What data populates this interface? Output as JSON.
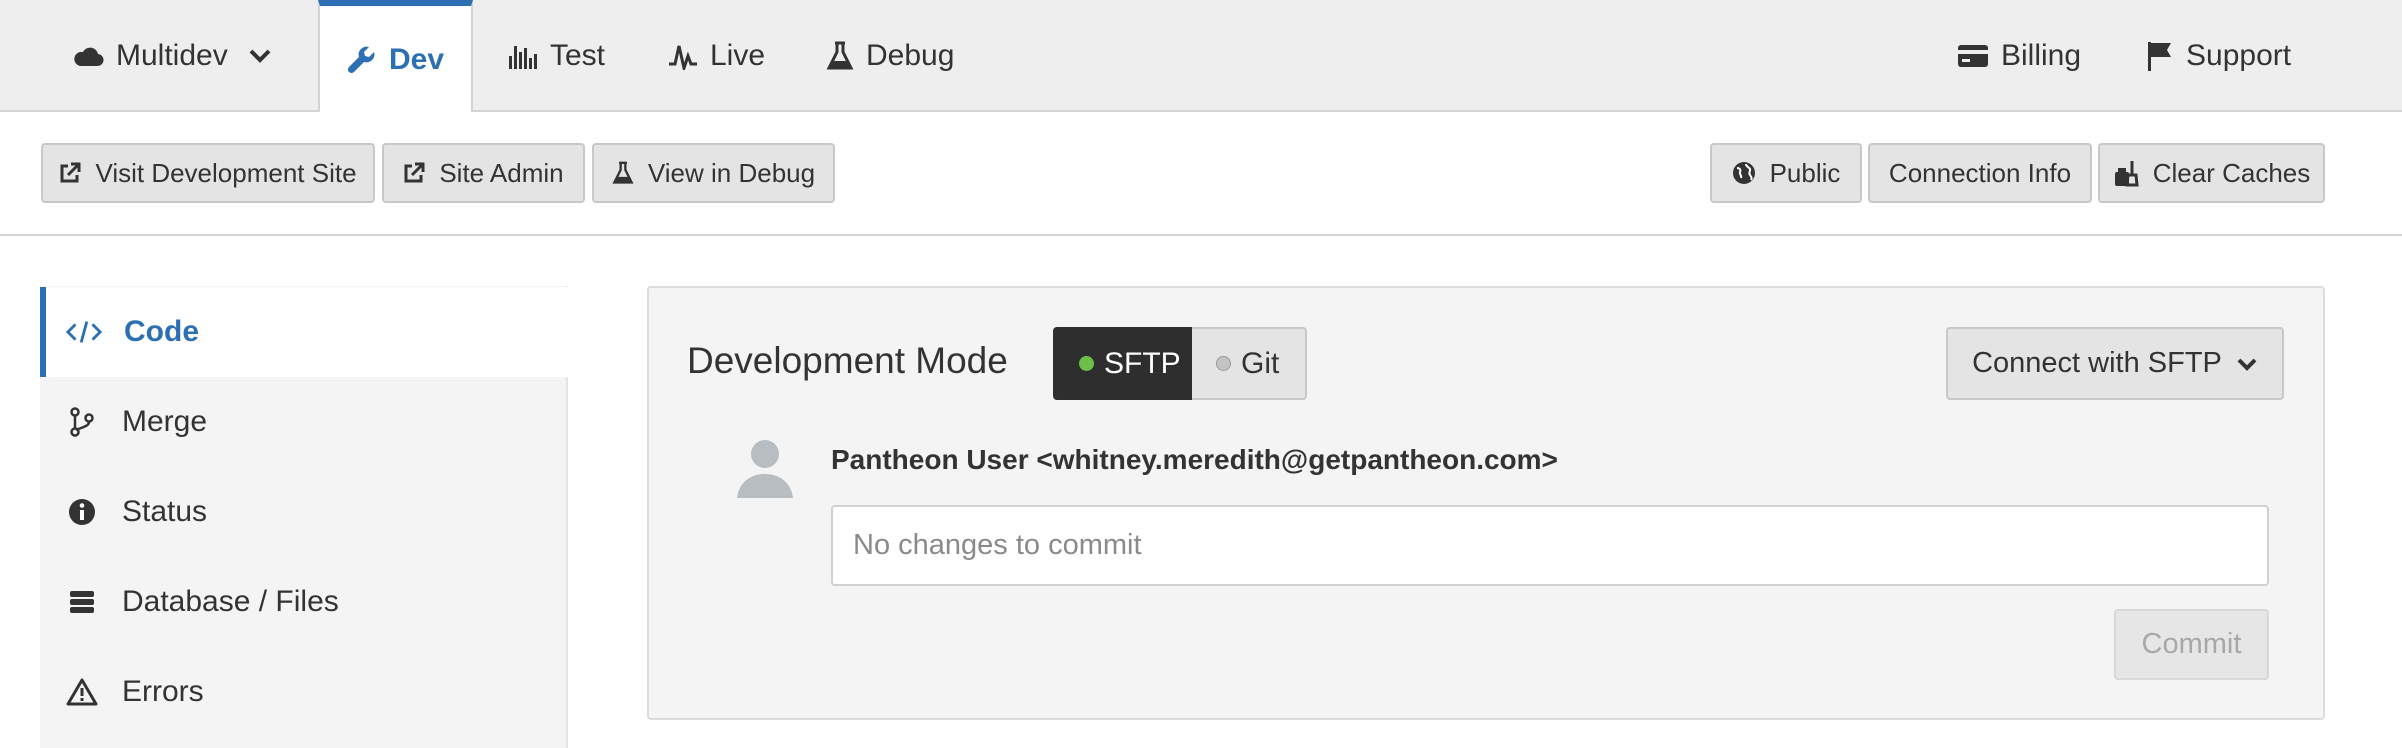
{
  "topnav": {
    "environment_label": "Multidev",
    "tabs": [
      {
        "label": "Dev",
        "icon": "wrench-icon"
      },
      {
        "label": "Test",
        "icon": "bar-chart-icon"
      },
      {
        "label": "Live",
        "icon": "pulse-icon"
      },
      {
        "label": "Debug",
        "icon": "flask-icon"
      }
    ],
    "right_links": [
      {
        "label": "Billing",
        "icon": "credit-card-icon"
      },
      {
        "label": "Support",
        "icon": "flag-icon"
      }
    ]
  },
  "toolbar": {
    "left_buttons": [
      {
        "label": "Visit Development Site",
        "icon": "external-link-icon"
      },
      {
        "label": "Site Admin",
        "icon": "external-link-icon"
      },
      {
        "label": "View in Debug",
        "icon": "flask-icon"
      }
    ],
    "right_buttons": [
      {
        "label": "Public",
        "icon": "globe-icon"
      },
      {
        "label": "Connection Info"
      },
      {
        "label": "Clear Caches",
        "icon": "broom-icon"
      }
    ]
  },
  "sidebar": {
    "items": [
      {
        "label": "Code",
        "icon": "code-icon",
        "active": true
      },
      {
        "label": "Merge",
        "icon": "branch-icon"
      },
      {
        "label": "Status",
        "icon": "info-icon"
      },
      {
        "label": "Database / Files",
        "icon": "database-icon"
      },
      {
        "label": "Errors",
        "icon": "warning-icon"
      }
    ]
  },
  "main": {
    "title": "Development Mode",
    "mode_options": [
      {
        "label": "SFTP",
        "selected": true,
        "dot_color": "#6cc04a"
      },
      {
        "label": "Git",
        "selected": false,
        "dot_color": "#c4c4c4"
      }
    ],
    "connect_label": "Connect with SFTP",
    "author": "Pantheon User <whitney.meredith@getpantheon.com>",
    "commit_placeholder": "No changes to commit",
    "commit_label": "Commit"
  },
  "colors": {
    "accent": "#2d6fb3",
    "nav_bg": "#eeeeee",
    "panel_bg": "#f4f4f4",
    "selected_segment": "#2e2e2e"
  }
}
